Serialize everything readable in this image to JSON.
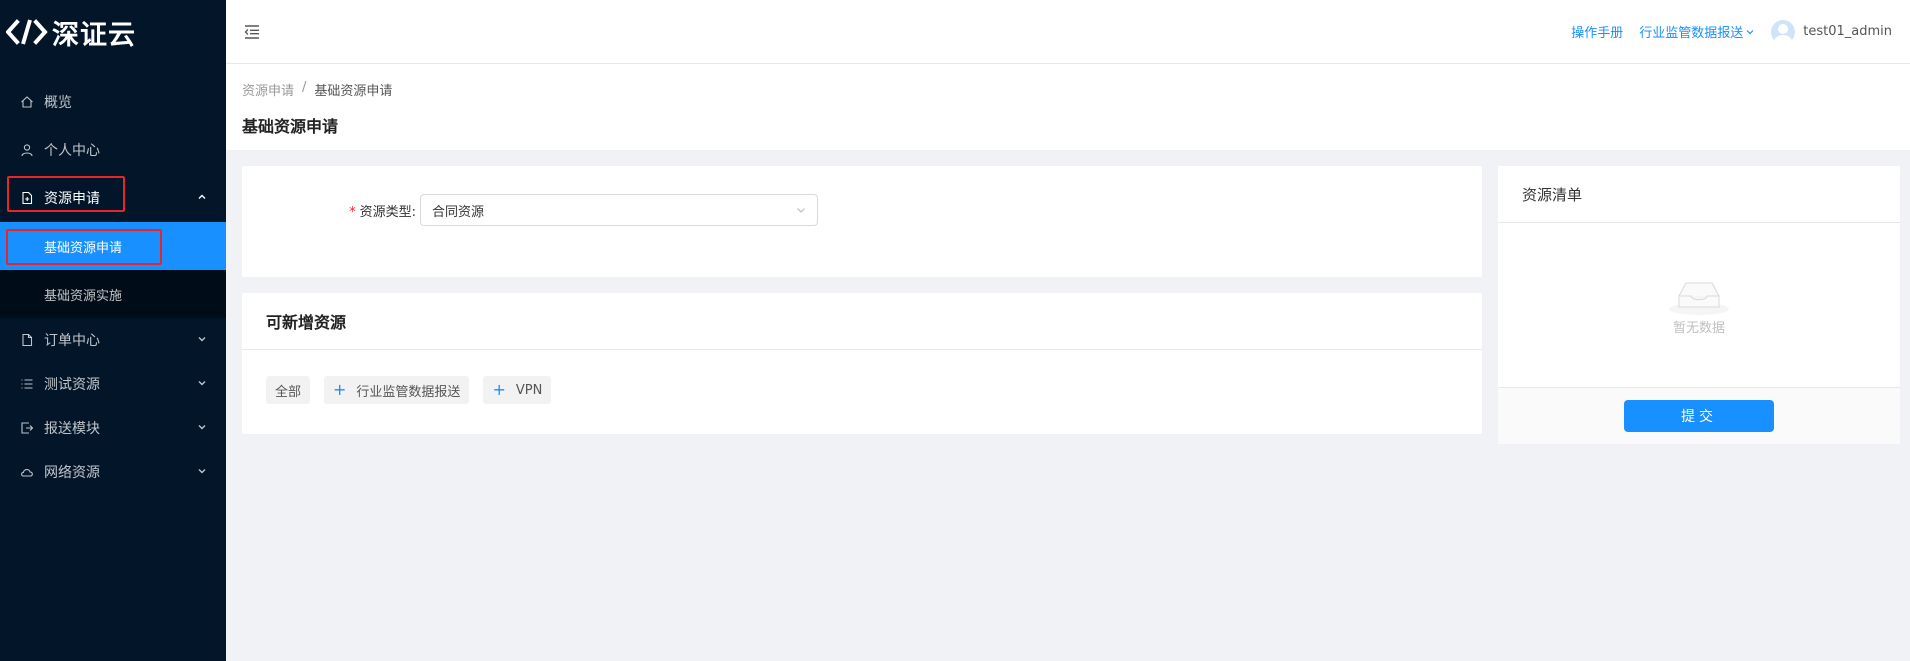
{
  "app": {
    "logo_text": "深证云"
  },
  "sidebar": {
    "items": [
      {
        "label": "概览",
        "icon": "home-icon"
      },
      {
        "label": "个人中心",
        "icon": "user-icon"
      },
      {
        "label": "资源申请",
        "icon": "file-add-icon",
        "expanded": true,
        "children": [
          {
            "label": "基础资源申请",
            "active": true
          },
          {
            "label": "基础资源实施"
          }
        ]
      },
      {
        "label": "订单中心",
        "icon": "file-icon"
      },
      {
        "label": "测试资源",
        "icon": "list-icon"
      },
      {
        "label": "报送模块",
        "icon": "export-icon"
      },
      {
        "label": "网络资源",
        "icon": "cloud-icon"
      }
    ],
    "highlight_color": "#e8252a",
    "active_color": "#1890ff"
  },
  "header": {
    "manual_link": "操作手册",
    "dropdown_label": "行业监管数据报送",
    "username": "test01_admin"
  },
  "breadcrumb": [
    "资源申请",
    "基础资源申请"
  ],
  "page_title": "基础资源申请",
  "form": {
    "resource_type_label": "资源类型:",
    "resource_type_value": "合同资源"
  },
  "available_resources": {
    "title": "可新增资源",
    "tags": [
      "全部",
      "行业监管数据报送",
      "VPN"
    ]
  },
  "resource_list": {
    "title": "资源清单",
    "empty_text": "暂无数据",
    "submit_label": "提交"
  }
}
